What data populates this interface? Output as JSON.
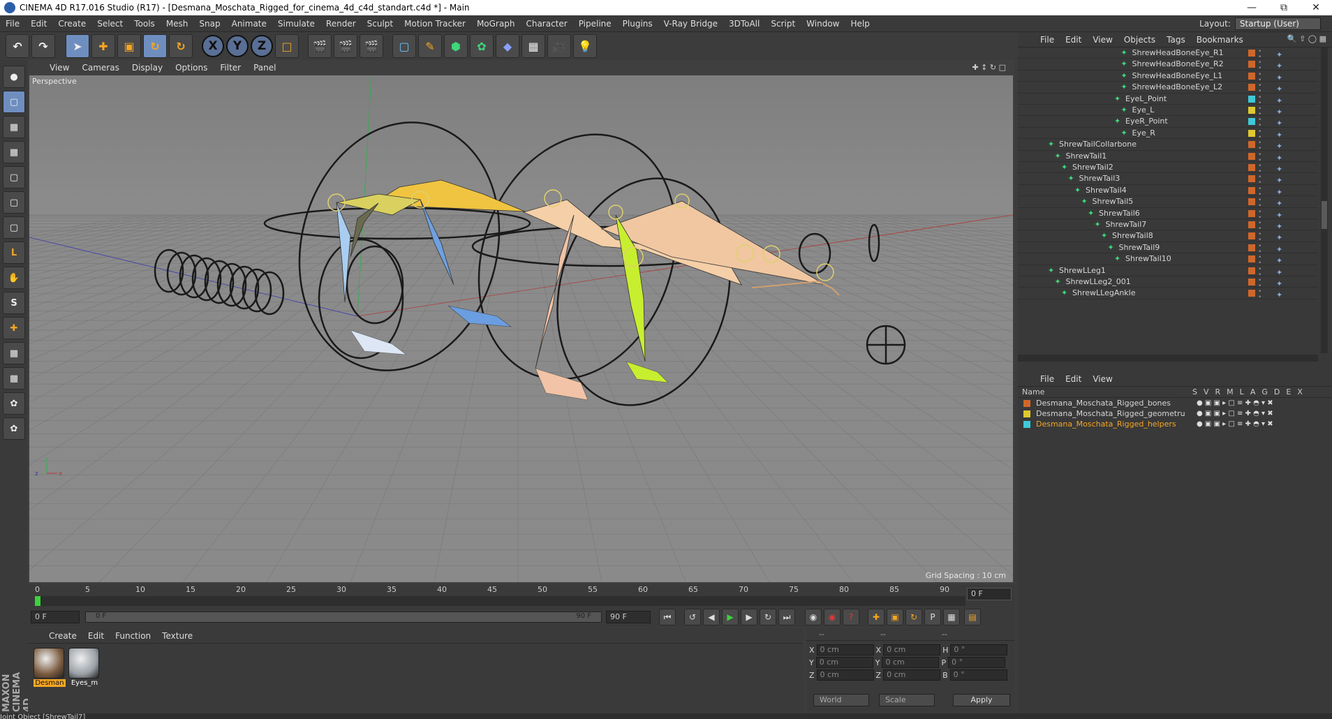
{
  "window": {
    "title": "CINEMA 4D R17.016 Studio (R17) - [Desmana_Moschata_Rigged_for_cinema_4d_c4d_standart.c4d *] - Main"
  },
  "menubar": [
    "File",
    "Edit",
    "Create",
    "Select",
    "Tools",
    "Mesh",
    "Snap",
    "Animate",
    "Simulate",
    "Render",
    "Sculpt",
    "Motion Tracker",
    "MoGraph",
    "Character",
    "Pipeline",
    "Plugins",
    "V-Ray Bridge",
    "3DToAll",
    "Script",
    "Window",
    "Help"
  ],
  "layout": {
    "label": "Layout:",
    "value": "Startup (User)"
  },
  "viewport": {
    "menu": [
      "View",
      "Cameras",
      "Display",
      "Options",
      "Filter",
      "Panel"
    ],
    "label": "Perspective",
    "grid_spacing": "Grid Spacing : 10 cm"
  },
  "timeline": {
    "ticks": [
      "0",
      "5",
      "10",
      "15",
      "20",
      "25",
      "30",
      "35",
      "40",
      "45",
      "50",
      "55",
      "60",
      "65",
      "70",
      "75",
      "80",
      "85",
      "90"
    ],
    "current_frame": "0 F",
    "start_field": "0 F",
    "range_start": "0 F",
    "range_end": "90 F",
    "end_field": "90 F"
  },
  "material_panel": {
    "menu": [
      "Create",
      "Edit",
      "Function",
      "Texture"
    ],
    "materials": [
      {
        "name": "Desman",
        "color": "#7a5a3e",
        "selected": true
      },
      {
        "name": "Eyes_m",
        "color": "#9aa0a6",
        "selected": false
      }
    ]
  },
  "coords": {
    "headers": [
      "--",
      "--",
      "--"
    ],
    "rows": [
      {
        "a": "X",
        "v1": "0 cm",
        "b": "X",
        "v2": "0 cm",
        "c": "H",
        "v3": "0 °"
      },
      {
        "a": "Y",
        "v1": "0 cm",
        "b": "Y",
        "v2": "0 cm",
        "c": "P",
        "v3": "0 °"
      },
      {
        "a": "Z",
        "v1": "0 cm",
        "b": "Z",
        "v2": "0 cm",
        "c": "B",
        "v3": "0 °"
      }
    ],
    "world": "World",
    "scale": "Scale",
    "apply": "Apply"
  },
  "object_manager": {
    "menu": [
      "File",
      "Edit",
      "View",
      "Objects",
      "Tags",
      "Bookmarks"
    ],
    "rows": [
      {
        "name": "ShrewHeadBoneEye_R1",
        "depth": 13,
        "color": "#d0672a"
      },
      {
        "name": "ShrewHeadBoneEye_R2",
        "depth": 13,
        "color": "#d0672a"
      },
      {
        "name": "ShrewHeadBoneEye_L1",
        "depth": 13,
        "color": "#d0672a"
      },
      {
        "name": "ShrewHeadBoneEye_L2",
        "depth": 13,
        "color": "#d0672a"
      },
      {
        "name": "EyeL_Point",
        "depth": 12,
        "color": "#3fc8d8"
      },
      {
        "name": "Eye_L",
        "depth": 13,
        "color": "#e0c830"
      },
      {
        "name": "EyeR_Point",
        "depth": 12,
        "color": "#3fc8d8"
      },
      {
        "name": "Eye_R",
        "depth": 13,
        "color": "#e0c830"
      },
      {
        "name": "ShrewTailCollarbone",
        "depth": 2,
        "color": "#d0672a"
      },
      {
        "name": "ShrewTail1",
        "depth": 3,
        "color": "#d0672a"
      },
      {
        "name": "ShrewTail2",
        "depth": 4,
        "color": "#d0672a"
      },
      {
        "name": "ShrewTail3",
        "depth": 5,
        "color": "#d0672a"
      },
      {
        "name": "ShrewTail4",
        "depth": 6,
        "color": "#d0672a"
      },
      {
        "name": "ShrewTail5",
        "depth": 7,
        "color": "#d0672a"
      },
      {
        "name": "ShrewTail6",
        "depth": 8,
        "color": "#d0672a"
      },
      {
        "name": "ShrewTail7",
        "depth": 9,
        "color": "#d0672a"
      },
      {
        "name": "ShrewTail8",
        "depth": 10,
        "color": "#d0672a"
      },
      {
        "name": "ShrewTail9",
        "depth": 11,
        "color": "#d0672a"
      },
      {
        "name": "ShrewTail10",
        "depth": 12,
        "color": "#d0672a"
      },
      {
        "name": "ShrewLLeg1",
        "depth": 2,
        "color": "#d0672a"
      },
      {
        "name": "ShrewLLeg2_001",
        "depth": 3,
        "color": "#d0672a"
      },
      {
        "name": "ShrewLLegAnkle",
        "depth": 4,
        "color": "#d0672a"
      }
    ]
  },
  "layer_manager": {
    "menu": [
      "File",
      "Edit",
      "View"
    ],
    "header": {
      "name": "Name",
      "cols": [
        "S",
        "V",
        "R",
        "M",
        "L",
        "A",
        "G",
        "D",
        "E",
        "X"
      ]
    },
    "rows": [
      {
        "name": "Desmana_Moschata_Rigged_bones",
        "color": "#d0672a",
        "selected": false
      },
      {
        "name": "Desmana_Moschata_Rigged_geometru",
        "color": "#e0c830",
        "selected": false
      },
      {
        "name": "Desmana_Moschata_Rigged_helpers",
        "color": "#3fc8d8",
        "selected": true
      }
    ]
  },
  "statusbar": "Joint Object [ShrewTail7]",
  "brand": "MAXON CINEMA 4D"
}
